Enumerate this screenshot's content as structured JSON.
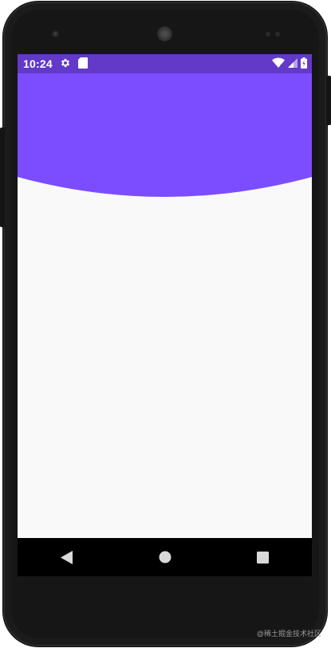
{
  "status_bar": {
    "time": "10:24",
    "bg_color": "#6239c9",
    "icons_left": [
      "gear-icon",
      "sd-card-icon"
    ],
    "icons_right": [
      "wifi-icon",
      "signal-icon",
      "battery-icon"
    ]
  },
  "header": {
    "color": "#7c4dff"
  },
  "content": {
    "bg_color": "#f9f9f9"
  },
  "nav_bar": {
    "buttons": [
      "back-button",
      "home-button",
      "recents-button"
    ]
  },
  "watermark": "@稀土掘金技术社区"
}
